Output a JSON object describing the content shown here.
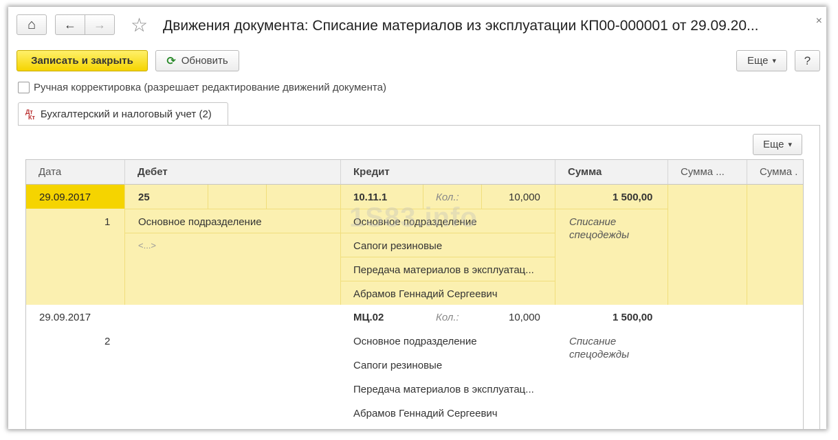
{
  "window": {
    "title": "Движения документа: Списание материалов из эксплуатации КП00-000001 от 29.09.20...",
    "close_glyph": "×"
  },
  "nav": {
    "home_glyph": "⌂",
    "back_glyph": "←",
    "forward_glyph": "→",
    "star_glyph": "☆"
  },
  "toolbar": {
    "save_close": "Записать и закрыть",
    "refresh": "Обновить",
    "refresh_glyph": "⟳",
    "more": "Еще",
    "more_arrow": "▾",
    "help": "?"
  },
  "manual": {
    "label": "Ручная корректировка (разрешает редактирование движений документа)"
  },
  "tab": {
    "icon_top": "Дт",
    "icon_bottom": "Кт",
    "label": "Бухгалтерский и налоговый учет (2)"
  },
  "table": {
    "more": "Еще",
    "headers": {
      "date": "Дата",
      "debit": "Дебет",
      "credit": "Кредит",
      "sum": "Сумма",
      "sum2": "Сумма ...",
      "sum3": "Сумма ."
    },
    "rows": [
      {
        "date": "29.09.2017",
        "num": "1",
        "debit_account": "25",
        "debit_sub1": "Основное подразделение",
        "debit_sub2": "<...>",
        "credit_account": "10.11.1",
        "qty_label": "Кол.:",
        "qty": "10,000",
        "credit_sub1": "Основное подразделение",
        "credit_sub2": "Сапоги резиновые",
        "credit_sub3": "Передача материалов в эксплуатац...",
        "credit_sub4": "Абрамов Геннадий Сергеевич",
        "amount": "1 500,00",
        "content_line1": "Списание",
        "content_line2": "спецодежды"
      },
      {
        "date": "29.09.2017",
        "num": "2",
        "credit_account": "МЦ.02",
        "qty_label": "Кол.:",
        "qty": "10,000",
        "credit_sub1": "Основное подразделение",
        "credit_sub2": "Сапоги резиновые",
        "credit_sub3": "Передача материалов в эксплуатац...",
        "credit_sub4": "Абрамов Геннадий Сергеевич",
        "amount": "1 500,00",
        "content_line1": "Списание",
        "content_line2": "спецодежды"
      }
    ]
  },
  "watermark": "1S83.info"
}
